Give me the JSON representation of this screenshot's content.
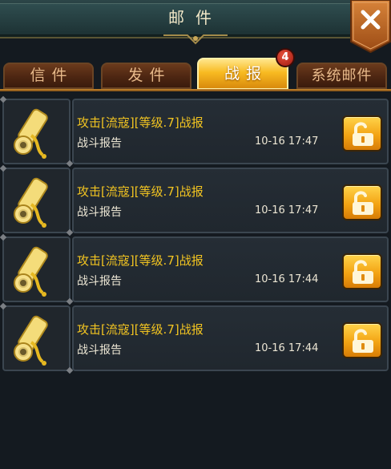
{
  "header": {
    "title": "邮件"
  },
  "tabs": [
    {
      "label": "信件"
    },
    {
      "label": "发件"
    },
    {
      "label": "战报",
      "badge": "4"
    },
    {
      "label": "系统邮件"
    }
  ],
  "messages": [
    {
      "title": "攻击[流寇][等级.7]战报",
      "subtitle": "战斗报告",
      "time": "10-16 17:47"
    },
    {
      "title": "攻击[流寇][等级.7]战报",
      "subtitle": "战斗报告",
      "time": "10-16 17:47"
    },
    {
      "title": "攻击[流寇][等级.7]战报",
      "subtitle": "战斗报告",
      "time": "10-16 17:44"
    },
    {
      "title": "攻击[流寇][等级.7]战报",
      "subtitle": "战斗报告",
      "time": "10-16 17:44"
    }
  ],
  "icons": {
    "close": "close-icon",
    "scroll": "scroll-icon",
    "lock": "unlocked-padlock-icon"
  },
  "colors": {
    "accent": "#f3a414",
    "title_text": "#f2c421",
    "active_tab": "#f8bb22"
  }
}
